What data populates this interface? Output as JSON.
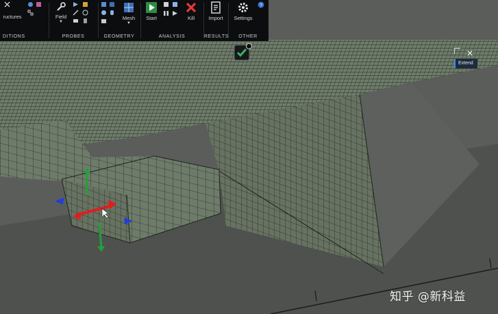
{
  "ribbon": {
    "groups": [
      {
        "label": "DITIONS",
        "tools": [
          {
            "label": "ructures",
            "icon": "structures-icon"
          }
        ]
      },
      {
        "label": "PROBES",
        "tools": [
          {
            "label": "Field",
            "icon": "field-probe-icon"
          }
        ]
      },
      {
        "label": "GEOMETRY",
        "tools": [
          {
            "label": "Mesh",
            "icon": "mesh-icon"
          }
        ]
      },
      {
        "label": "ANALYSIS",
        "tools": [
          {
            "label": "Start",
            "icon": "start-icon"
          },
          {
            "label": "Kill",
            "icon": "kill-icon"
          }
        ]
      },
      {
        "label": "RESULTS",
        "tools": [
          {
            "label": "Import",
            "icon": "import-icon"
          }
        ]
      },
      {
        "label": "OTHER",
        "tools": [
          {
            "label": "Settings",
            "icon": "settings-icon"
          }
        ]
      }
    ],
    "help_icon": "help-icon"
  },
  "viewport": {
    "done_icon": "checkmark-icon",
    "extend_panel": {
      "label": "Extend",
      "close_icon": "close-icon"
    }
  },
  "colors": {
    "ribbon_bg": "#0c0d0f",
    "mesh_line": "#1c2a1c",
    "mesh_fill": "#6f7b6a",
    "floor": "#5a5c5a",
    "gizmo_x": "#e01e1e",
    "gizmo_y": "#1fa33a",
    "gizmo_z": "#1f3fd8",
    "extend_accent": "#3a8de0"
  },
  "watermark": "知乎 @新科益"
}
